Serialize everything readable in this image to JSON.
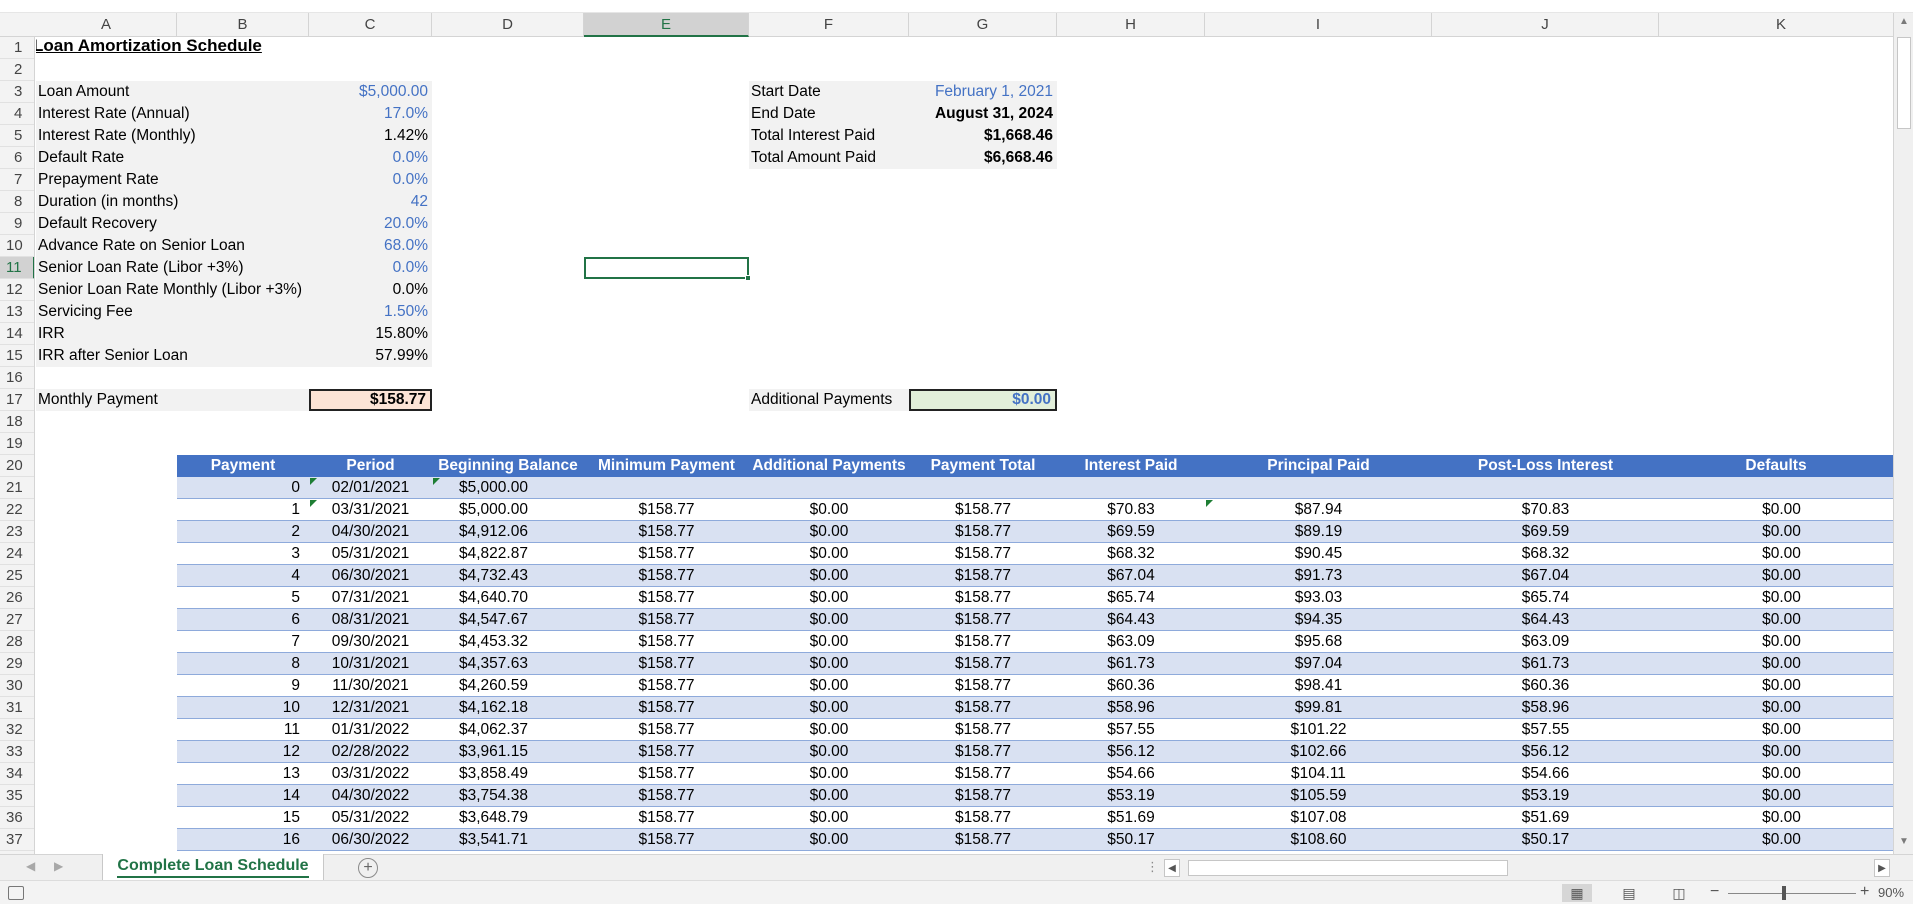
{
  "columns": [
    "A",
    "B",
    "C",
    "D",
    "E",
    "F",
    "G",
    "H",
    "I",
    "J",
    "K"
  ],
  "selected_column": "E",
  "selected_row": "11",
  "title": "Loan Amortization Schedule",
  "params": [
    {
      "row": "3",
      "label": "Loan Amount",
      "value": "$5,000.00",
      "blue": true
    },
    {
      "row": "4",
      "label": "Interest Rate (Annual)",
      "value": "17.0%",
      "blue": true
    },
    {
      "row": "5",
      "label": "Interest Rate (Monthly)",
      "value": "1.42%",
      "blue": false
    },
    {
      "row": "6",
      "label": "Default Rate",
      "value": "0.0%",
      "blue": true
    },
    {
      "row": "7",
      "label": "Prepayment Rate",
      "value": "0.0%",
      "blue": true
    },
    {
      "row": "8",
      "label": "Duration (in months)",
      "value": "42",
      "blue": true
    },
    {
      "row": "9",
      "label": "Default Recovery",
      "value": "20.0%",
      "blue": true
    },
    {
      "row": "10",
      "label": "Advance Rate on Senior Loan",
      "value": "68.0%",
      "blue": true
    },
    {
      "row": "11",
      "label": "Senior Loan Rate (Libor +3%)",
      "value": "0.0%",
      "blue": true
    },
    {
      "row": "12",
      "label": "Senior Loan Rate Monthly (Libor +3%)",
      "value": "0.0%",
      "blue": false
    },
    {
      "row": "13",
      "label": "Servicing Fee",
      "value": "1.50%",
      "blue": true
    },
    {
      "row": "14",
      "label": "IRR",
      "value": "15.80%",
      "blue": false
    },
    {
      "row": "15",
      "label": "IRR after Senior Loan",
      "value": "57.99%",
      "blue": false
    }
  ],
  "summary": [
    {
      "label": "Start Date",
      "value": "February 1, 2021",
      "blue": true,
      "bold": false
    },
    {
      "label": "End Date",
      "value": "August 31, 2024",
      "blue": false,
      "bold": true
    },
    {
      "label": "Total Interest Paid",
      "value": "$1,668.46",
      "blue": false,
      "bold": true
    },
    {
      "label": "Total Amount Paid",
      "value": "$6,668.46",
      "blue": false,
      "bold": true
    }
  ],
  "monthly_payment": {
    "label": "Monthly Payment",
    "value": "$158.77",
    "fill": "#fce4d6"
  },
  "additional_payments": {
    "label": "Additional Payments",
    "value": "$0.00",
    "fill": "#e2efda"
  },
  "table_headers": [
    "Payment",
    "Period",
    "Beginning Balance",
    "Minimum Payment",
    "Additional Payments",
    "Payment Total",
    "Interest Paid",
    "Principal Paid",
    "Post-Loss Interest",
    "Defaults"
  ],
  "table_rows": [
    [
      "0",
      "02/01/2021",
      "$5,000.00",
      "",
      "",
      "",
      "",
      "",
      "",
      ""
    ],
    [
      "1",
      "03/31/2021",
      "$5,000.00",
      "$158.77",
      "$0.00",
      "$158.77",
      "$70.83",
      "$87.94",
      "$70.83",
      "$0.00"
    ],
    [
      "2",
      "04/30/2021",
      "$4,912.06",
      "$158.77",
      "$0.00",
      "$158.77",
      "$69.59",
      "$89.19",
      "$69.59",
      "$0.00"
    ],
    [
      "3",
      "05/31/2021",
      "$4,822.87",
      "$158.77",
      "$0.00",
      "$158.77",
      "$68.32",
      "$90.45",
      "$68.32",
      "$0.00"
    ],
    [
      "4",
      "06/30/2021",
      "$4,732.43",
      "$158.77",
      "$0.00",
      "$158.77",
      "$67.04",
      "$91.73",
      "$67.04",
      "$0.00"
    ],
    [
      "5",
      "07/31/2021",
      "$4,640.70",
      "$158.77",
      "$0.00",
      "$158.77",
      "$65.74",
      "$93.03",
      "$65.74",
      "$0.00"
    ],
    [
      "6",
      "08/31/2021",
      "$4,547.67",
      "$158.77",
      "$0.00",
      "$158.77",
      "$64.43",
      "$94.35",
      "$64.43",
      "$0.00"
    ],
    [
      "7",
      "09/30/2021",
      "$4,453.32",
      "$158.77",
      "$0.00",
      "$158.77",
      "$63.09",
      "$95.68",
      "$63.09",
      "$0.00"
    ],
    [
      "8",
      "10/31/2021",
      "$4,357.63",
      "$158.77",
      "$0.00",
      "$158.77",
      "$61.73",
      "$97.04",
      "$61.73",
      "$0.00"
    ],
    [
      "9",
      "11/30/2021",
      "$4,260.59",
      "$158.77",
      "$0.00",
      "$158.77",
      "$60.36",
      "$98.41",
      "$60.36",
      "$0.00"
    ],
    [
      "10",
      "12/31/2021",
      "$4,162.18",
      "$158.77",
      "$0.00",
      "$158.77",
      "$58.96",
      "$99.81",
      "$58.96",
      "$0.00"
    ],
    [
      "11",
      "01/31/2022",
      "$4,062.37",
      "$158.77",
      "$0.00",
      "$158.77",
      "$57.55",
      "$101.22",
      "$57.55",
      "$0.00"
    ],
    [
      "12",
      "02/28/2022",
      "$3,961.15",
      "$158.77",
      "$0.00",
      "$158.77",
      "$56.12",
      "$102.66",
      "$56.12",
      "$0.00"
    ],
    [
      "13",
      "03/31/2022",
      "$3,858.49",
      "$158.77",
      "$0.00",
      "$158.77",
      "$54.66",
      "$104.11",
      "$54.66",
      "$0.00"
    ],
    [
      "14",
      "04/30/2022",
      "$3,754.38",
      "$158.77",
      "$0.00",
      "$158.77",
      "$53.19",
      "$105.59",
      "$53.19",
      "$0.00"
    ],
    [
      "15",
      "05/31/2022",
      "$3,648.79",
      "$158.77",
      "$0.00",
      "$158.77",
      "$51.69",
      "$107.08",
      "$51.69",
      "$0.00"
    ],
    [
      "16",
      "06/30/2022",
      "$3,541.71",
      "$158.77",
      "$0.00",
      "$158.77",
      "$50.17",
      "$108.60",
      "$50.17",
      "$0.00"
    ]
  ],
  "sheet_tab": "Complete Loan Schedule",
  "add_sheet_symbol": "+",
  "zoom": "90%",
  "zoom_out_symbol": "−",
  "zoom_in_symbol": "+",
  "colors": {
    "accent": "#217346",
    "table_header": "#4472c4",
    "band": "#d9e1f2",
    "input_blue": "#4472c4"
  },
  "icons": [
    "select-all-icon",
    "macro-record-icon",
    "normal-view-icon",
    "page-layout-icon",
    "page-break-icon",
    "add-sheet-icon"
  ]
}
